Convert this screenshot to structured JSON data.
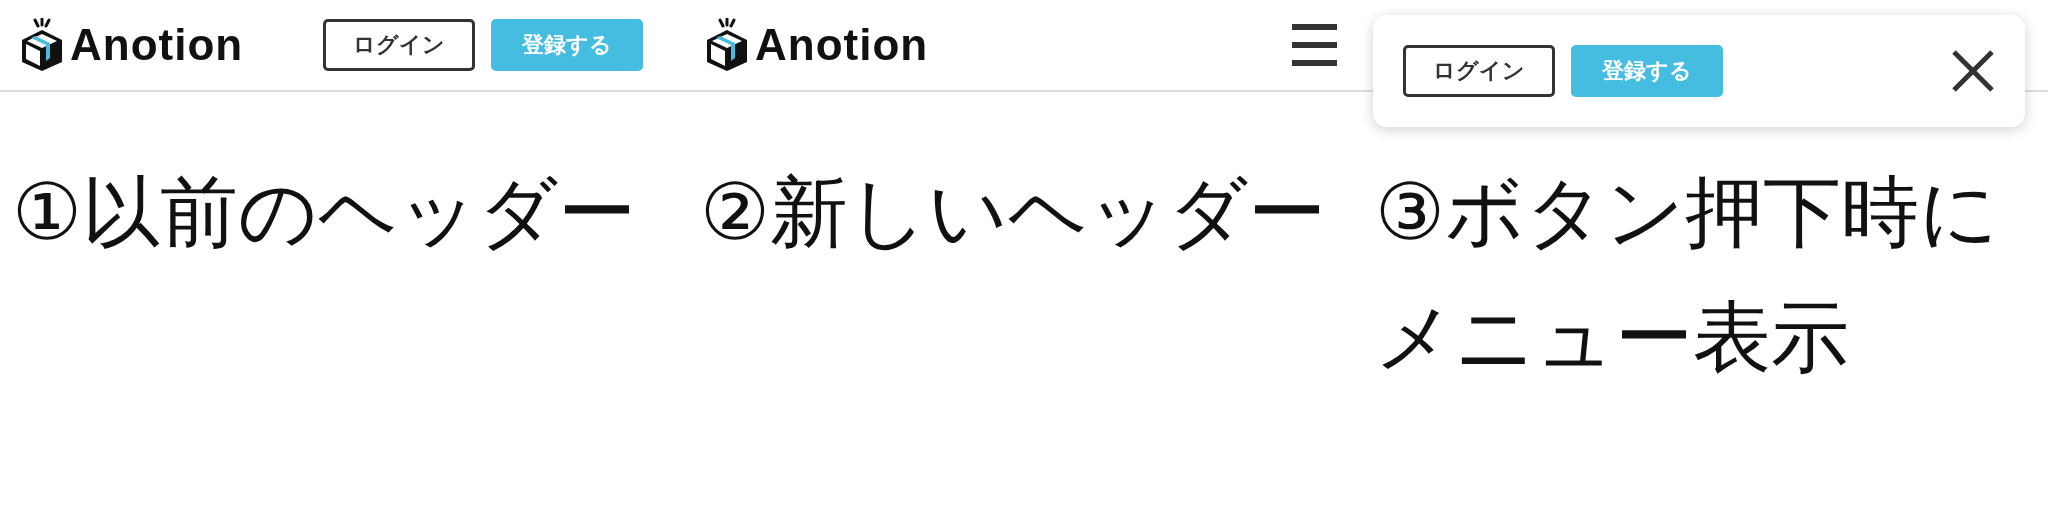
{
  "panels": [
    {
      "kind": "old_header",
      "logo": "Anotion",
      "buttons": [
        {
          "label": "ログイン",
          "kind": "outline"
        },
        {
          "label": "登録する",
          "kind": "primary"
        }
      ],
      "caption": "①以前のヘッダー"
    },
    {
      "kind": "new_header",
      "logo": "Anotion",
      "caption": "②新しいヘッダー"
    },
    {
      "kind": "menu_open",
      "buttons": [
        {
          "label": "ログイン",
          "kind": "outline"
        },
        {
          "label": "登録する",
          "kind": "primary"
        }
      ],
      "caption": "③ボタン押下時にメニュー表示"
    }
  ]
}
